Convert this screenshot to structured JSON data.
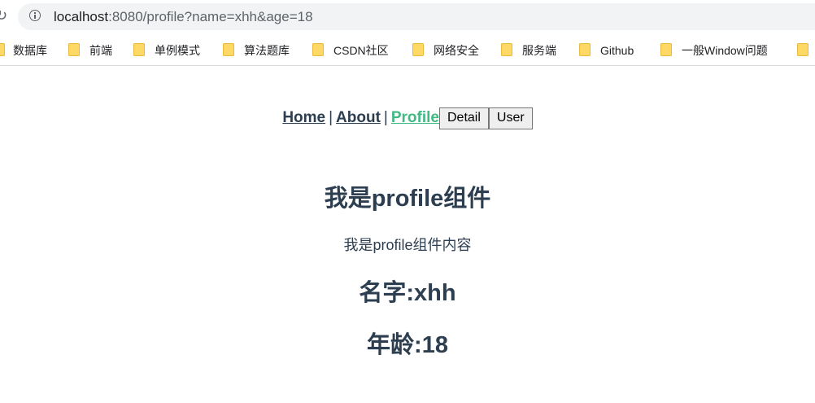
{
  "browser": {
    "url_host": "localhost",
    "url_rest": ":8080/profile?name=xhh&age=18",
    "bookmarks": [
      "数据库",
      "前端",
      "单例模式",
      "算法题库",
      "CSDN社区",
      "网络安全",
      "服务端",
      "Github",
      "一般Window问题"
    ]
  },
  "nav": {
    "home": "Home",
    "about": "About",
    "profile": "Profile",
    "separator": "|",
    "detail_button": "Detail",
    "user_button": "User",
    "active_color": "#42b983",
    "text_color": "#2c3e50"
  },
  "profile": {
    "title": "我是profile组件",
    "content": "我是profile组件内容",
    "name_line": "名字:xhh",
    "age_line": "年龄:18"
  }
}
